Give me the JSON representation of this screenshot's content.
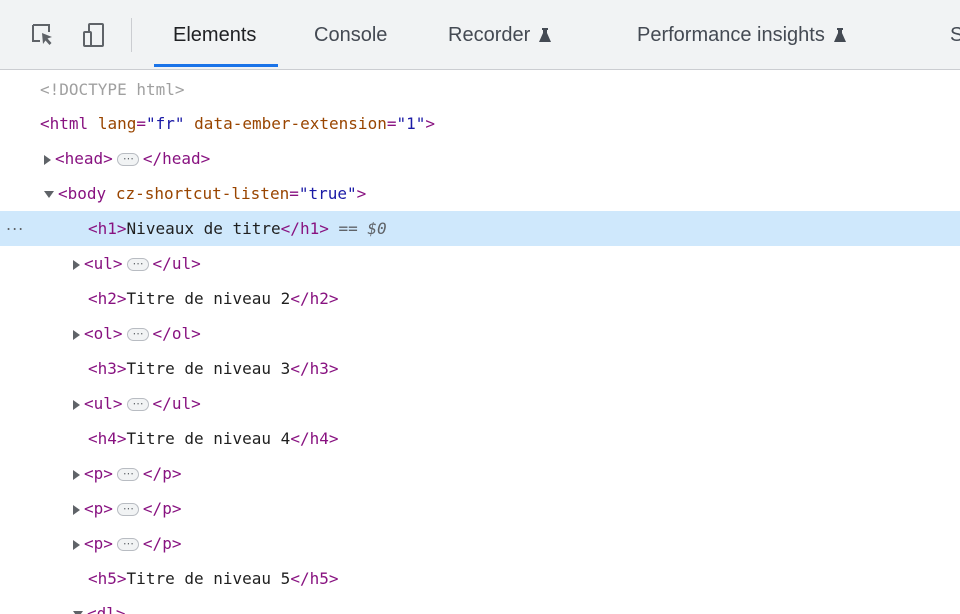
{
  "toolbar": {
    "inspect_icon": "select-element-icon",
    "device_icon": "device-toolbar-icon",
    "tabs": [
      {
        "label": "Elements",
        "active": true
      },
      {
        "label": "Console"
      },
      {
        "label": "Recorder",
        "icon": "flask-icon"
      },
      {
        "label": "Performance insights",
        "icon": "flask-icon"
      },
      {
        "label": "S"
      }
    ]
  },
  "tree": {
    "selected_marker": "...",
    "eq_label": "== $0",
    "collapsed_placeholder": "⋯",
    "doctype": "<!DOCTYPE html>",
    "html": {
      "tag": "html",
      "attrs": [
        {
          "name": "lang",
          "value": "fr"
        },
        {
          "name": "data-ember-extension",
          "value": "1"
        }
      ]
    },
    "head": {
      "tag": "head"
    },
    "body": {
      "tag": "body",
      "attrs": [
        {
          "name": "cz-shortcut-listen",
          "value": "true"
        }
      ]
    },
    "nodes": [
      {
        "tag": "h1",
        "text": "Niveaux de titre"
      },
      {
        "tag": "ul"
      },
      {
        "tag": "h2",
        "text": "Titre de niveau 2"
      },
      {
        "tag": "ol"
      },
      {
        "tag": "h3",
        "text": "Titre de niveau 3"
      },
      {
        "tag": "ul"
      },
      {
        "tag": "h4",
        "text": "Titre de niveau 4"
      },
      {
        "tag": "p"
      },
      {
        "tag": "p"
      },
      {
        "tag": "p"
      },
      {
        "tag": "h5",
        "text": "Titre de niveau 5"
      },
      {
        "tag": "dl"
      }
    ]
  },
  "colors": {
    "accent": "#1a73e8",
    "selection": "#cfe8fc",
    "tag": "#881280",
    "attr_name": "#994500",
    "attr_value": "#1a1aa6"
  }
}
